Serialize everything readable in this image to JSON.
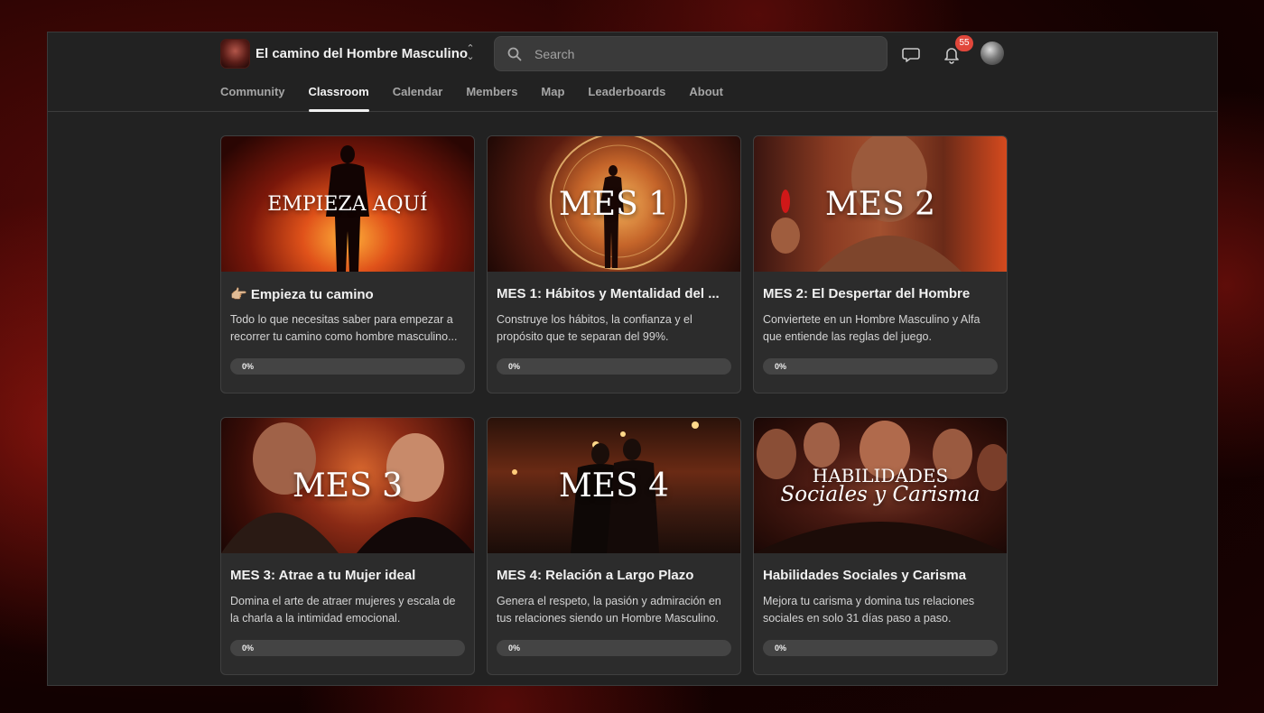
{
  "header": {
    "group_name": "El camino del Hombre Masculino",
    "search_placeholder": "Search",
    "notification_count": "55"
  },
  "tabs": [
    {
      "label": "Community",
      "active": false
    },
    {
      "label": "Classroom",
      "active": true
    },
    {
      "label": "Calendar",
      "active": false
    },
    {
      "label": "Members",
      "active": false
    },
    {
      "label": "Map",
      "active": false
    },
    {
      "label": "Leaderboards",
      "active": false
    },
    {
      "label": "About",
      "active": false
    }
  ],
  "courses": [
    {
      "thumb_text": "EMPIEZA AQUÍ",
      "title": "👉🏼 Empieza tu camino",
      "description": "Todo lo que necesitas saber para empezar a recorrer tu camino como hombre masculino...",
      "progress": "0%",
      "progress_value": 0
    },
    {
      "thumb_text": "MES 1",
      "title": "MES 1: Hábitos y Mentalidad del ...",
      "description": "Construye los hábitos, la confianza y el propósito que te separan del 99%.",
      "progress": "0%",
      "progress_value": 0
    },
    {
      "thumb_text": "MES 2",
      "title": "MES 2: El Despertar del Hombre",
      "description": "Conviertete en un Hombre Masculino y Alfa que entiende las reglas del juego.",
      "progress": "0%",
      "progress_value": 0
    },
    {
      "thumb_text": "MES 3",
      "title": "MES 3: Atrae a tu Mujer ideal",
      "description": "Domina el arte de atraer mujeres y escala de la charla a la intimidad emocional.",
      "progress": "0%",
      "progress_value": 0
    },
    {
      "thumb_text": "MES 4",
      "title": "MES 4: Relación a Largo Plazo",
      "description": "Genera el respeto, la pasión y admiración en tus relaciones siendo un Hombre Masculino.",
      "progress": "0%",
      "progress_value": 0
    },
    {
      "thumb_text": "HABILIDADES",
      "thumb_text2": "Sociales y Carisma",
      "title": "Habilidades Sociales y Carisma",
      "description": "Mejora tu carisma y domina tus relaciones sociales en solo 31 días paso a paso.",
      "progress": "0%",
      "progress_value": 0
    }
  ]
}
